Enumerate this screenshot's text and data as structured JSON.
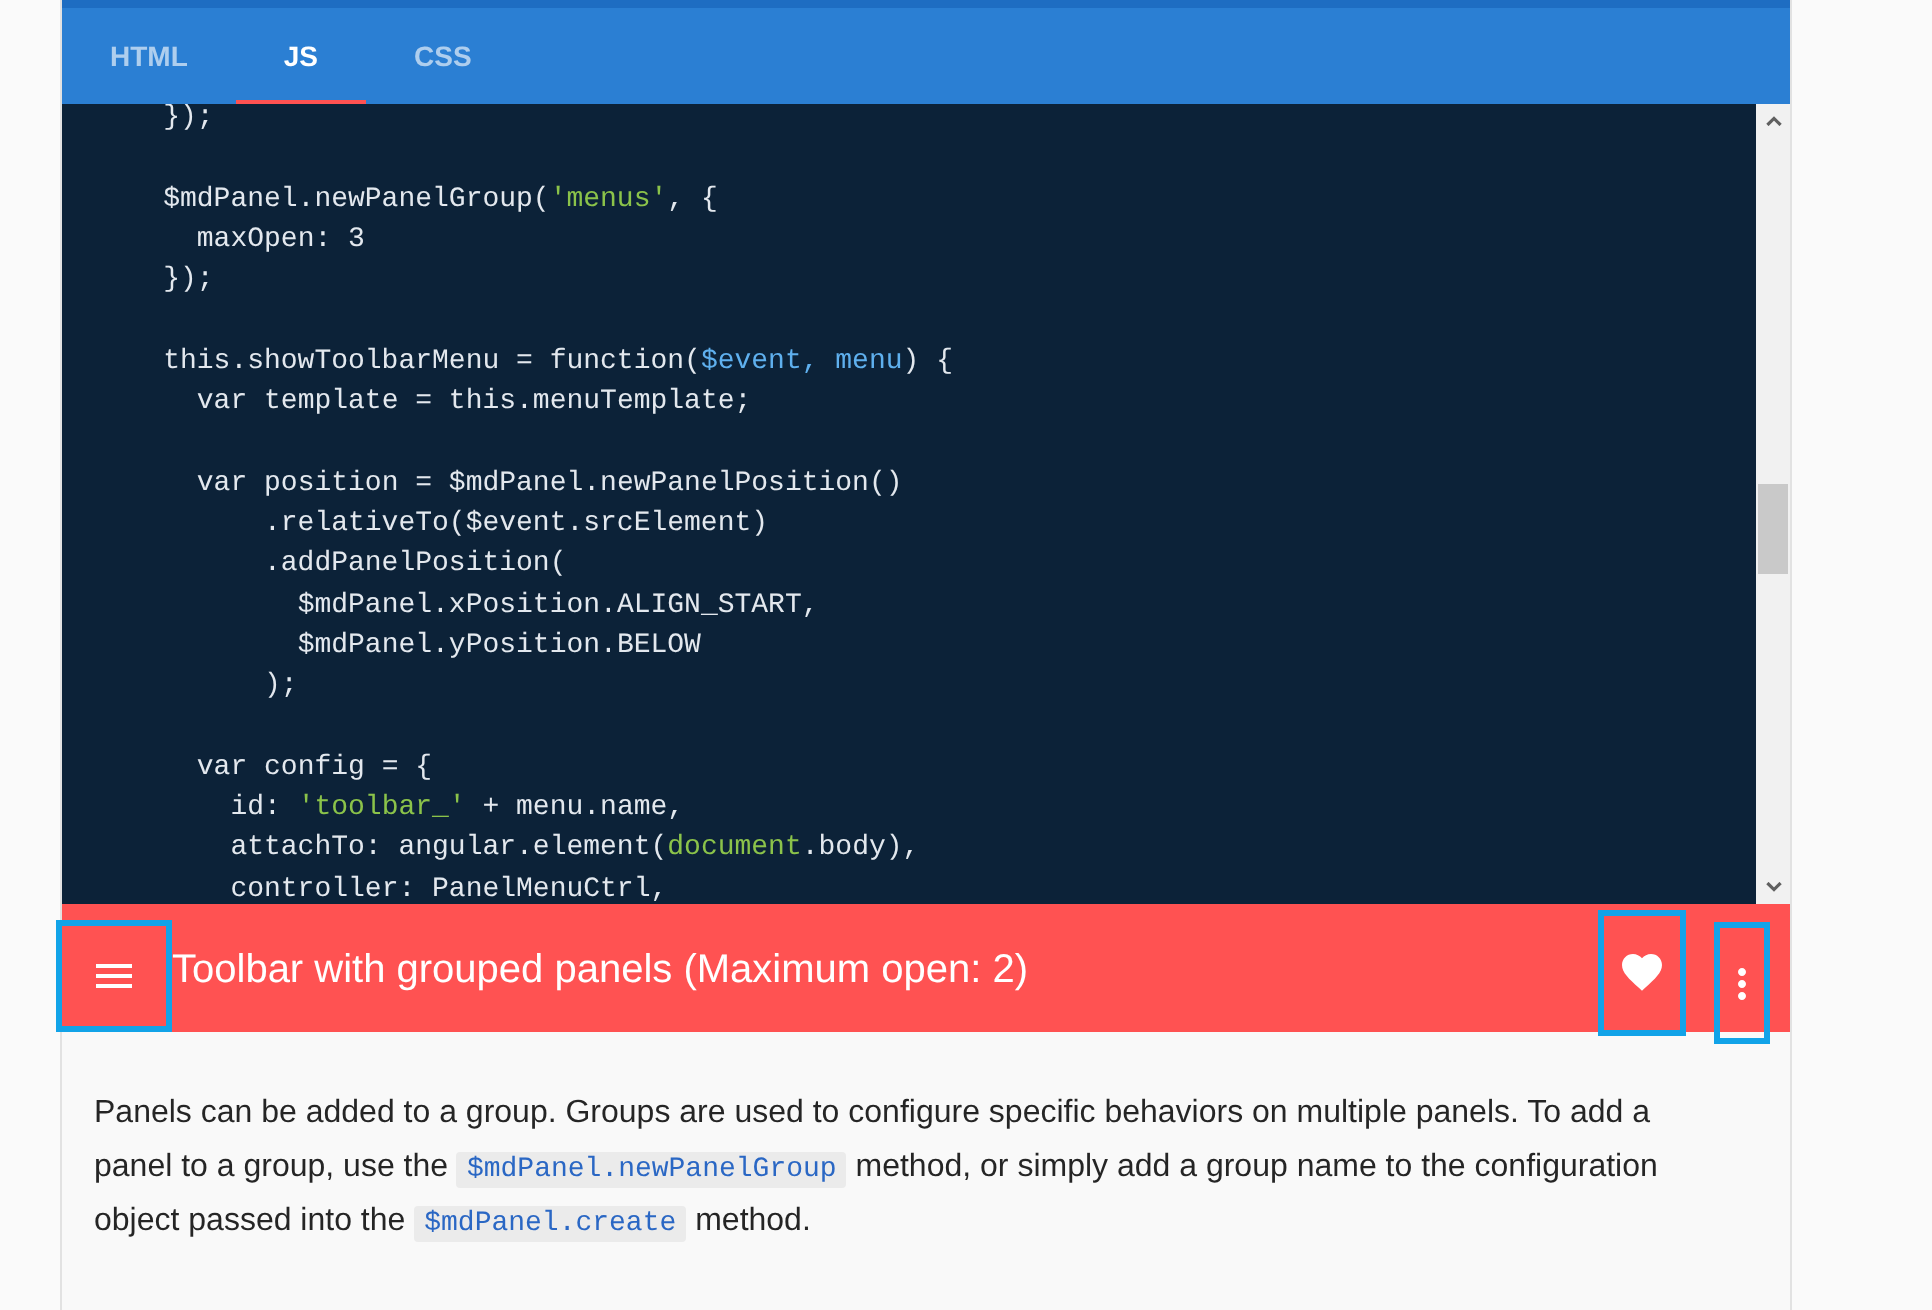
{
  "tabs": [
    {
      "label": "HTML",
      "selected": false
    },
    {
      "label": "JS",
      "selected": true
    },
    {
      "label": "CSS",
      "selected": false
    }
  ],
  "code": {
    "blocks": [
      [
        {
          "tokens": [
            {
              "text": "    });",
              "kind": "plain"
            }
          ]
        }
      ],
      [
        {
          "tokens": [
            {
              "text": "    $mdPanel.newPanelGroup(",
              "kind": "plain"
            },
            {
              "text": "'menus'",
              "kind": "string"
            },
            {
              "text": ", {",
              "kind": "plain"
            }
          ]
        },
        {
          "tokens": [
            {
              "text": "      maxOpen: 3",
              "kind": "plain"
            }
          ]
        },
        {
          "tokens": [
            {
              "text": "    });",
              "kind": "plain"
            }
          ]
        }
      ],
      [
        {
          "tokens": [
            {
              "text": "    this.showToolbarMenu = function(",
              "kind": "plain"
            },
            {
              "text": "$event, menu",
              "kind": "param"
            },
            {
              "text": ") {",
              "kind": "plain"
            }
          ]
        },
        {
          "tokens": [
            {
              "text": "      var template = this.menuTemplate;",
              "kind": "plain"
            }
          ]
        }
      ],
      [
        {
          "tokens": [
            {
              "text": "      var position = $mdPanel.newPanelPosition()",
              "kind": "plain"
            }
          ]
        },
        {
          "tokens": [
            {
              "text": "          .relativeTo($event.srcElement)",
              "kind": "plain"
            }
          ]
        },
        {
          "tokens": [
            {
              "text": "          .addPanelPosition(",
              "kind": "plain"
            }
          ]
        },
        {
          "tokens": [
            {
              "text": "            $mdPanel.xPosition.ALIGN_START,",
              "kind": "plain"
            }
          ]
        },
        {
          "tokens": [
            {
              "text": "            $mdPanel.yPosition.BELOW",
              "kind": "plain"
            }
          ]
        },
        {
          "tokens": [
            {
              "text": "          );",
              "kind": "plain"
            }
          ]
        }
      ],
      [
        {
          "tokens": [
            {
              "text": "      var config = {",
              "kind": "plain"
            }
          ]
        },
        {
          "tokens": [
            {
              "text": "        id: ",
              "kind": "plain"
            },
            {
              "text": "'toolbar_'",
              "kind": "string"
            },
            {
              "text": " + menu.name,",
              "kind": "plain"
            }
          ]
        },
        {
          "tokens": [
            {
              "text": "        attachTo: angular.element(",
              "kind": "plain"
            },
            {
              "text": "document",
              "kind": "builtin"
            },
            {
              "text": ".body),",
              "kind": "plain"
            }
          ]
        },
        {
          "tokens": [
            {
              "text": "        controller: PanelMenuCtrl,",
              "kind": "plain"
            }
          ]
        }
      ]
    ]
  },
  "toolbar": {
    "menu_button": {
      "highlighted": true
    },
    "title": "Toolbar with grouped panels (Maximum open: 2)",
    "actions": [
      {
        "kind": "favorite",
        "highlighted": true
      },
      {
        "kind": "more",
        "highlighted": true
      }
    ]
  },
  "description": {
    "segments": [
      {
        "text": "Panels can be added to a group. Groups are used to configure specific behaviors on multiple panels. To add a panel to a group, use the ",
        "kind": "text"
      },
      {
        "text": "$mdPanel.newPanelGroup",
        "kind": "code"
      },
      {
        "text": " method, or simply add a group name to the configuration object passed into the ",
        "kind": "text"
      },
      {
        "text": "$mdPanel.create",
        "kind": "code"
      },
      {
        "text": " method.",
        "kind": "text"
      }
    ]
  }
}
